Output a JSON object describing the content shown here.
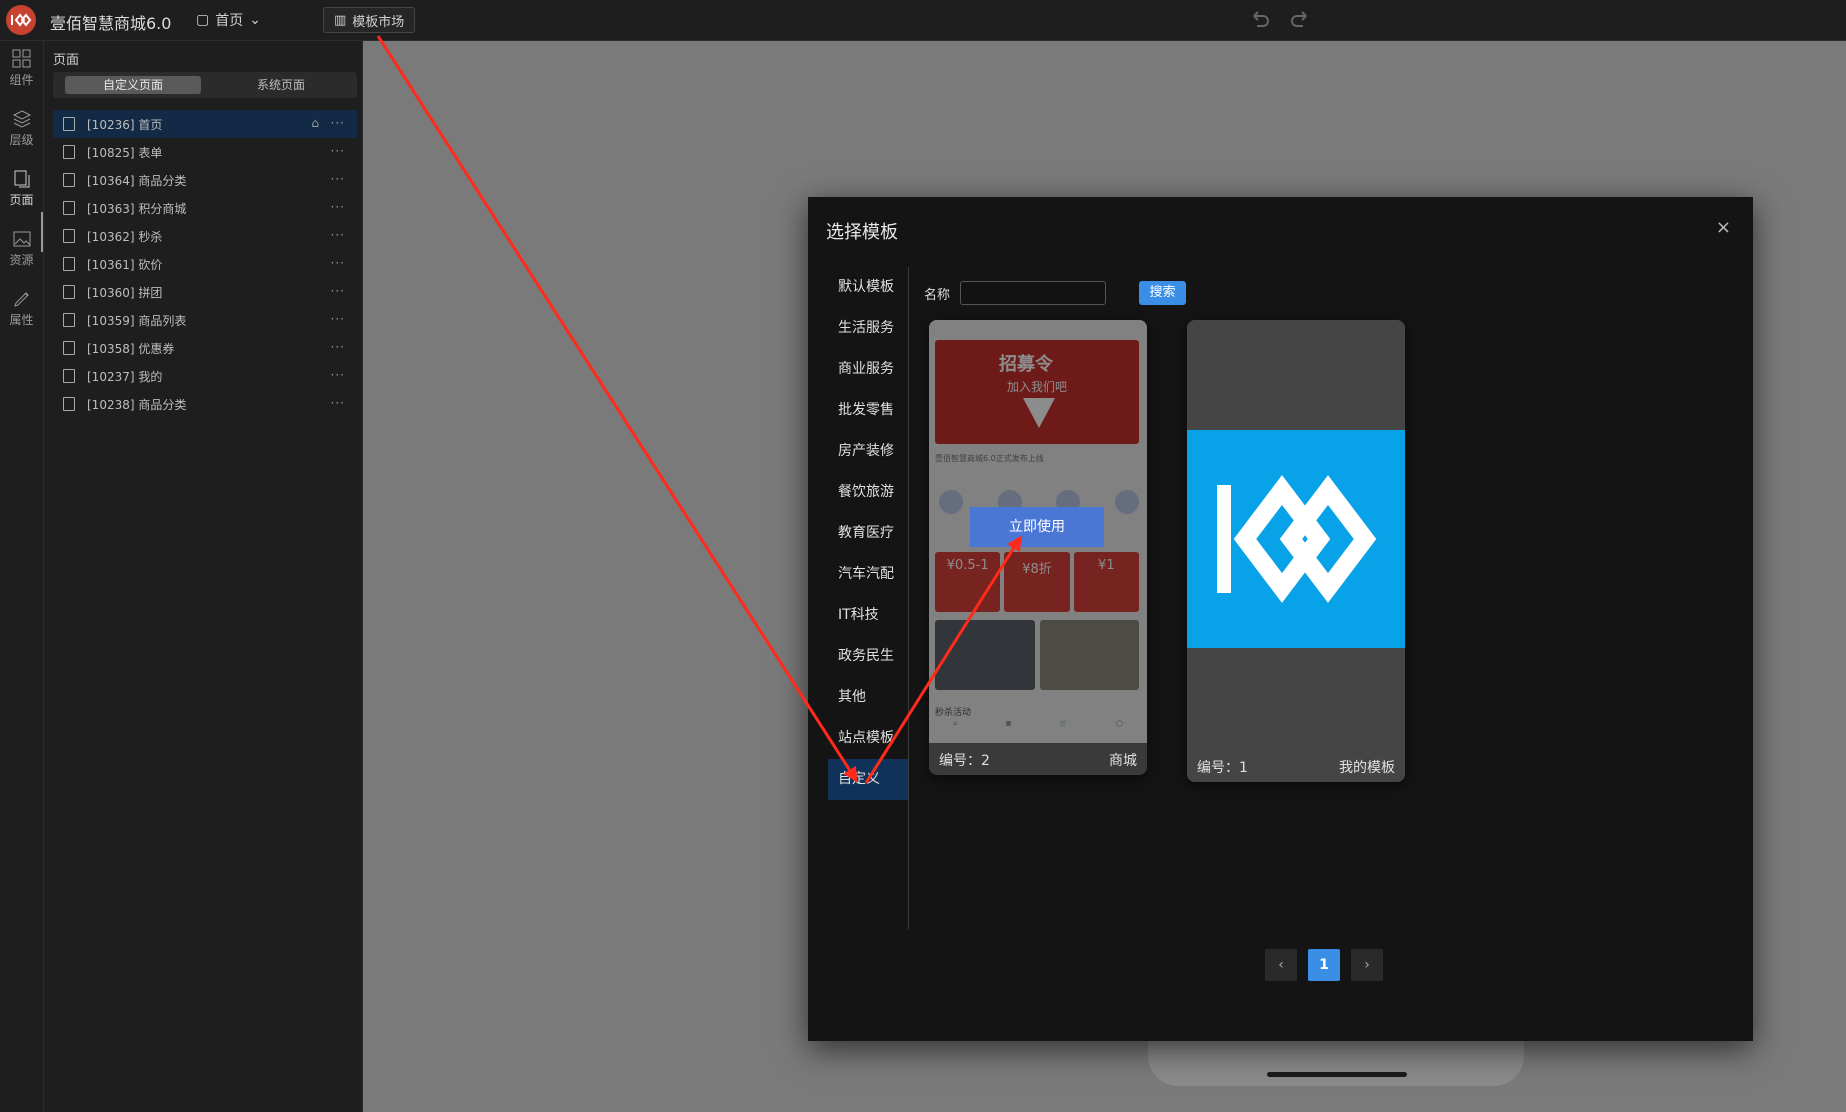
{
  "app": {
    "title": "壹佰智慧商城6.0",
    "current_page": "首页",
    "template_market": "模板市场"
  },
  "rail": [
    {
      "label": "组件",
      "icon": "grid-icon"
    },
    {
      "label": "层级",
      "icon": "layers-icon"
    },
    {
      "label": "页面",
      "icon": "page-icon"
    },
    {
      "label": "资源",
      "icon": "image-icon"
    },
    {
      "label": "属性",
      "icon": "edit-icon"
    }
  ],
  "sidebar": {
    "title": "页面",
    "tabs": [
      "自定义页面",
      "系统页面"
    ],
    "pages": [
      "[10236] 首页",
      "[10825] 表单",
      "[10364] 商品分类",
      "[10363] 积分商城",
      "[10362] 秒杀",
      "[10361] 砍价",
      "[10360] 拼团",
      "[10359] 商品列表",
      "[10358] 优惠券",
      "[10237] 我的",
      "[10238] 商品分类"
    ]
  },
  "modal": {
    "title": "选择模板",
    "close": "×",
    "categories": [
      "默认模板",
      "生活服务",
      "商业服务",
      "批发零售",
      "房产装修",
      "餐饮旅游",
      "教育医疗",
      "汽车汽配",
      "IT科技",
      "政务民生",
      "其他",
      "站点模板",
      "自定义"
    ],
    "search": {
      "label": "名称",
      "button": "搜索"
    },
    "use_button": "立即使用",
    "cards": [
      {
        "number": "编号：2",
        "type": "商城"
      },
      {
        "number": "编号：1",
        "type": "我的模板"
      }
    ],
    "preview": {
      "banner_title": "招募令",
      "banner_sub": "加入我们吧",
      "notice": "壹佰智慧商城6.0正式发布上线",
      "coupons": [
        "¥0.5-1",
        "¥8折",
        "¥1"
      ],
      "section": "秒杀活动"
    },
    "pager": {
      "prev": "‹",
      "current": "1",
      "next": "›"
    }
  },
  "colors": {
    "accent": "#3a8ee6",
    "selected": "#10325a",
    "arrow": "#ff2a1a"
  }
}
